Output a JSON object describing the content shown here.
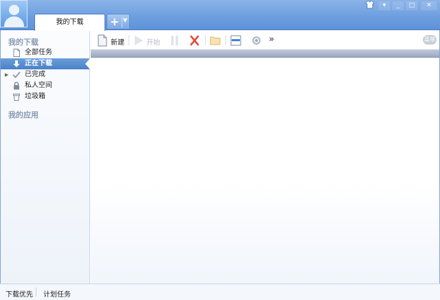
{
  "window": {
    "tab_label": "我的下载",
    "new_tab_symbol": "+",
    "controls": [
      "skin-icon",
      "menu-icon",
      "minimize-icon",
      "maximize-icon",
      "close-icon"
    ]
  },
  "sidebar": {
    "section_downloads": "我的下载",
    "items": [
      {
        "label": "全部任务",
        "icon": "document-icon"
      },
      {
        "label": "正在下载",
        "icon": "download-arrow-icon"
      },
      {
        "label": "已完成",
        "icon": "check-icon"
      },
      {
        "label": "私人空间",
        "icon": "lock-icon"
      },
      {
        "label": "垃圾箱",
        "icon": "trash-icon"
      }
    ],
    "section_apps": "我的应用"
  },
  "toolbar": {
    "new_label": "新建",
    "start_label": "开始",
    "more_symbol": "»",
    "right_badge": "菜单"
  },
  "statusbar": {
    "item1": "下载优先",
    "item2": "计划任务"
  },
  "colors": {
    "title_bar": "#6b9ddf",
    "active_item": "#5a8fd0",
    "delete_red": "#e04a3a"
  }
}
